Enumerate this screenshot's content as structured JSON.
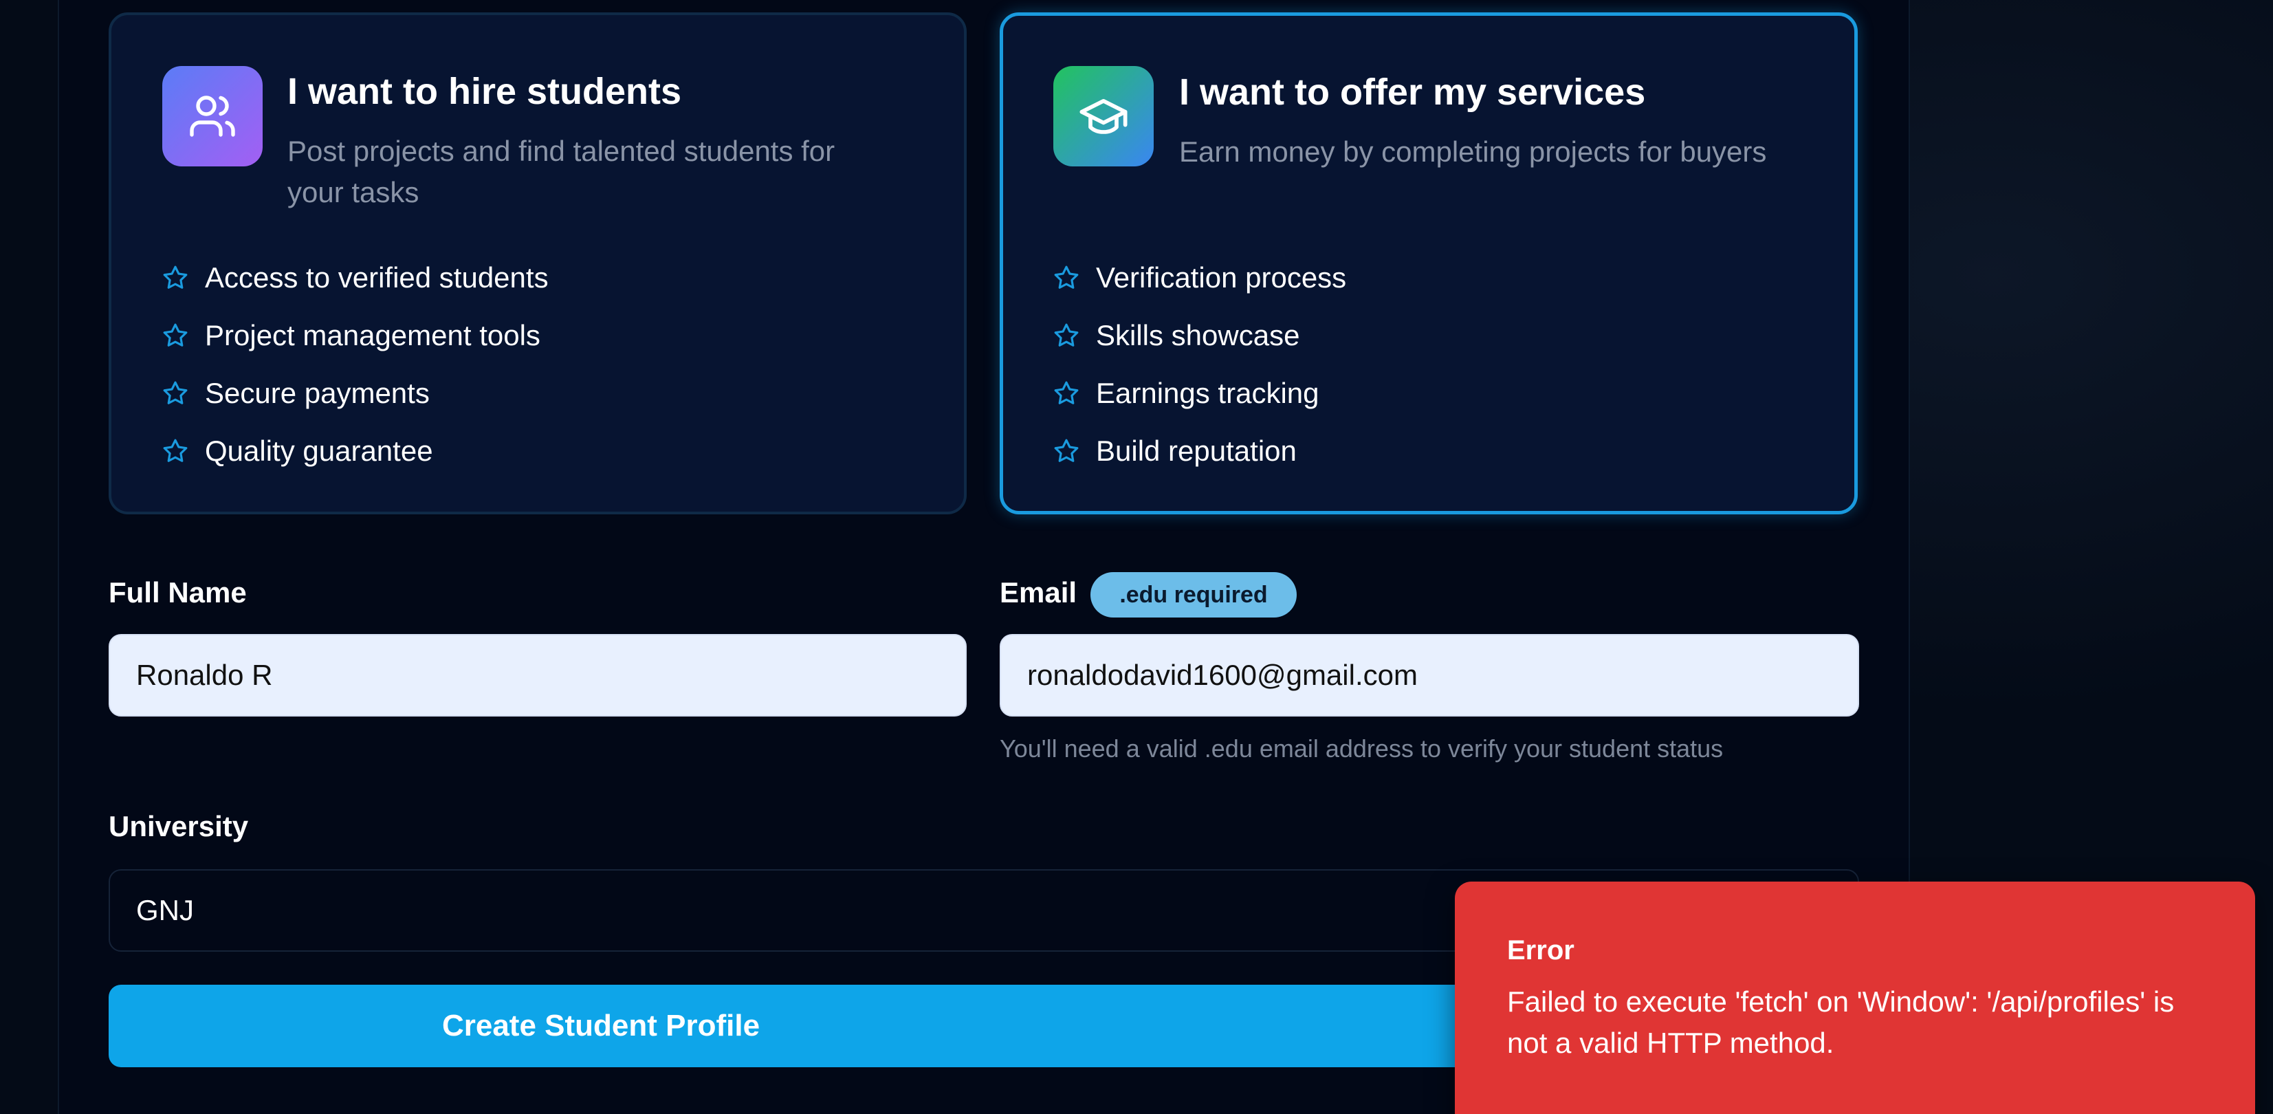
{
  "role_cards": {
    "hire": {
      "icon": "users-icon",
      "title": "I want to hire students",
      "description": "Post projects and find talented students for your tasks",
      "features": [
        "Access to verified students",
        "Project management tools",
        "Secure payments",
        "Quality guarantee"
      ]
    },
    "offer": {
      "icon": "graduation-cap-icon",
      "title": "I want to offer my services",
      "description": "Earn money by completing projects for buyers",
      "features": [
        "Verification process",
        "Skills showcase",
        "Earnings tracking",
        "Build reputation"
      ],
      "selected": true
    }
  },
  "form": {
    "full_name": {
      "label": "Full Name",
      "value": "Ronaldo R"
    },
    "email": {
      "label": "Email",
      "badge": ".edu required",
      "value": "ronaldodavid1600@gmail.com",
      "hint": "You'll need a valid .edu email address to verify your student status"
    },
    "university": {
      "label": "University",
      "value": "GNJ"
    },
    "submit_label": "Create Student Profile"
  },
  "toast": {
    "title": "Error",
    "message": "Failed to execute 'fetch' on 'Window': '/api/profiles' is not a valid HTTP method."
  },
  "colors": {
    "accent": "#0ea5e9",
    "selected_border": "#1a9bdf",
    "error": "#e03534",
    "star": "#1a9bdf"
  }
}
